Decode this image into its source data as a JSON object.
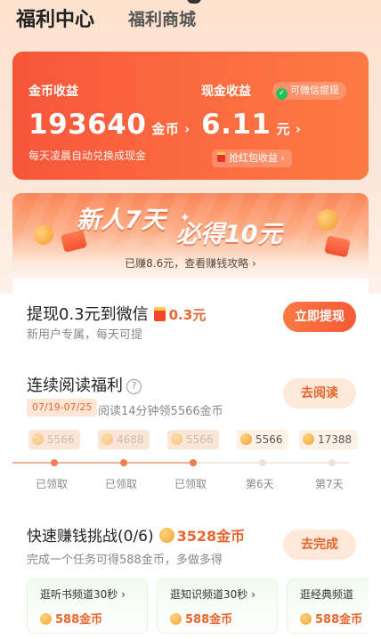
{
  "header": {
    "tab_active": "福利中心",
    "tab_inactive": "福利商城"
  },
  "earnings": {
    "coin_label": "金币收益",
    "coin_value": "193640",
    "coin_unit": "金币 ›",
    "coin_note": "每天凌晨自动兑换成现金",
    "cash_label": "现金收益",
    "wechat_badge": "可微信提现",
    "cash_value": "6.11",
    "cash_unit": "元 ›",
    "hongbao_pill": "抢红包收益 ›"
  },
  "banner": {
    "title_part1": "新人7天",
    "title_part2": "必得10元",
    "link": "已赚8.6元，查看赚钱攻略 ›"
  },
  "withdraw": {
    "title": "提现0.3元到微信",
    "amount": "0.3元",
    "subtitle": "新用户专属，每天可提",
    "button": "立即提现"
  },
  "reading": {
    "title": "连续阅读福利",
    "help": "?",
    "date_range": "07/19-07/25",
    "subtitle": "阅读14分钟领5566金币",
    "button": "去阅读",
    "days": [
      {
        "coins": "5566",
        "label": "已领取",
        "state": "claimed"
      },
      {
        "coins": "4688",
        "label": "已领取",
        "state": "claimed"
      },
      {
        "coins": "5566",
        "label": "已领取",
        "state": "claimed"
      },
      {
        "coins": "5566",
        "label": "第6天",
        "state": "future"
      },
      {
        "coins": "17388",
        "label": "第7天",
        "state": "future"
      }
    ]
  },
  "challenge": {
    "title": "快速赚钱挑战(0/6)",
    "reward": "3528金币",
    "subtitle": "完成一个任务可得588金币，多做多得",
    "button": "去完成",
    "tasks": [
      {
        "title": "逛听书频道30秒 ›",
        "reward": "588金币"
      },
      {
        "title": "逛知识频道30秒 ›",
        "reward": "588金币"
      },
      {
        "title": "逛经典频道",
        "reward": "588金币"
      }
    ]
  },
  "colors": {
    "accent": "#f55a35",
    "gold_text": "#e8662e",
    "card_bg": "#ffffff"
  }
}
